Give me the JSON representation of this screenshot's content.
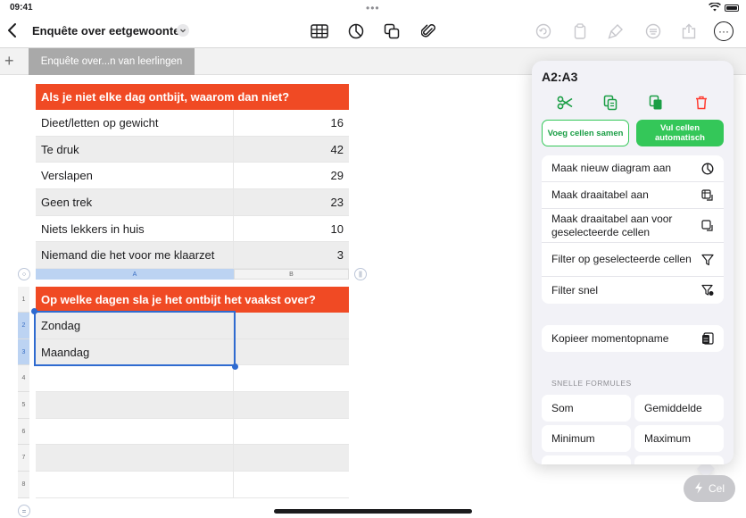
{
  "status": {
    "time": "09:41"
  },
  "toolbar": {
    "title": "Enquête over eetgewoonten"
  },
  "tabs": {
    "sheet_label": "Enquête over...n van leerlingen"
  },
  "table1": {
    "header": "Als je niet elke dag ontbijt, waarom dan niet?",
    "rows": [
      {
        "label": "Dieet/letten op gewicht",
        "value": "16"
      },
      {
        "label": "Te druk",
        "value": "42"
      },
      {
        "label": "Verslapen",
        "value": "29"
      },
      {
        "label": "Geen trek",
        "value": "23"
      },
      {
        "label": "Niets lekkers in huis",
        "value": "10"
      },
      {
        "label": "Niemand die het voor me klaarzet",
        "value": "3"
      }
    ]
  },
  "columns": {
    "a": "A",
    "b": "B"
  },
  "table2": {
    "header": "Op welke dagen sla je het ontbijt het vaakst over?",
    "rows": [
      {
        "label": "Zondag",
        "value": ""
      },
      {
        "label": "Maandag",
        "value": ""
      },
      {
        "label": "",
        "value": ""
      },
      {
        "label": "",
        "value": ""
      },
      {
        "label": "",
        "value": ""
      },
      {
        "label": "",
        "value": ""
      },
      {
        "label": "",
        "value": ""
      }
    ],
    "row_numbers": [
      "1",
      "2",
      "3",
      "4",
      "5",
      "6",
      "7",
      "8"
    ]
  },
  "popover": {
    "title": "A2:A3",
    "merge_label": "Voeg cellen samen",
    "fill_label": "Vul cellen automatisch",
    "menu1": [
      {
        "label": "Maak nieuw diagram aan",
        "icon": "chart-icon"
      },
      {
        "label": "Maak draaitabel aan",
        "icon": "pivot-table-icon"
      },
      {
        "label": "Maak draaitabel aan voor geselecteerde cellen",
        "icon": "pivot-selection-icon"
      },
      {
        "label": "Filter op geselecteerde cellen",
        "icon": "filter-icon"
      },
      {
        "label": "Filter snel",
        "icon": "quick-filter-icon"
      }
    ],
    "snapshot_label": "Kopieer momentopname",
    "section_label": "SNELLE FORMULES",
    "formulas": [
      "Som",
      "Gemiddelde",
      "Minimum",
      "Maximum"
    ]
  },
  "cell_button": {
    "label": "Cel"
  },
  "colors": {
    "accent_orange": "#f04a24",
    "green": "#34c759",
    "selection_blue": "#2f6bd0",
    "delete_red": "#ff3b30"
  }
}
